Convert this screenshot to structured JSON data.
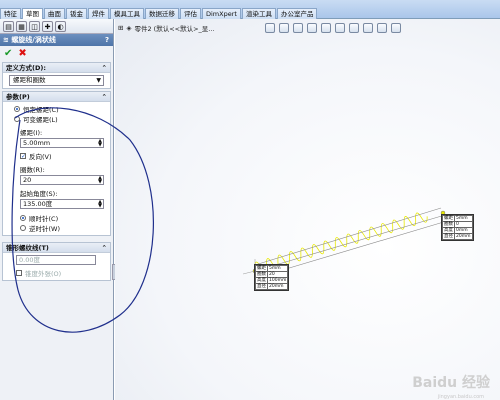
{
  "window": {
    "title_fragment": "特征 · 草图 · 钣金 · 焊件 · 模具工具 · 数据迁移 · 评估 · DimXpert · 渲染工具 · 办公室产品"
  },
  "ribbon": {
    "tabs": [
      "特征",
      "草图",
      "曲面",
      "钣金",
      "焊件",
      "模具工具",
      "数据迁移",
      "评估",
      "DimXpert",
      "渲染工具",
      "办公室产品"
    ],
    "active_tab": "草图"
  },
  "property_manager": {
    "title": "螺旋线/涡状线",
    "help": "?",
    "ok_icon": "check-icon",
    "cancel_icon": "x-icon",
    "definition": {
      "header": "定义方式(D):",
      "selected": "螺距和圈数"
    },
    "parameters": {
      "header": "参数(P)",
      "radio_constant": "恒定螺距(C)",
      "radio_variable": "可变螺距(L)",
      "pitch_label": "螺距(I):",
      "pitch_value": "5.00mm",
      "reverse_label": "反向(V)",
      "revolutions_label": "圈数(R):",
      "revolutions_value": "20",
      "start_angle_label": "起始角度(S):",
      "start_angle_value": "135.00度",
      "radio_cw": "顺时针(C)",
      "radio_ccw": "逆时针(W)"
    },
    "taper": {
      "header": "锥形螺纹线(T)",
      "angle_value": "0.00度",
      "outward_label": "锥度外张(O)"
    }
  },
  "graphics": {
    "tree_label": "零件2 (默认<<默认>_显...",
    "callout_right": [
      [
        "螺距",
        "5mm"
      ],
      [
        "圈数",
        "0"
      ],
      [
        "高度",
        "0mm"
      ],
      [
        "直径",
        "20mm"
      ]
    ],
    "callout_left": [
      [
        "螺距",
        "5mm"
      ],
      [
        "圈数",
        "20"
      ],
      [
        "高度",
        "100mm"
      ],
      [
        "直径",
        "20mm"
      ]
    ],
    "watermark": "Baidu 经验",
    "watermark_url": "jingyan.baidu.com"
  },
  "colors": {
    "helix": "#e8e800",
    "annotation_ink": "#1f2f8c",
    "pm_title": "#4e74a8"
  }
}
